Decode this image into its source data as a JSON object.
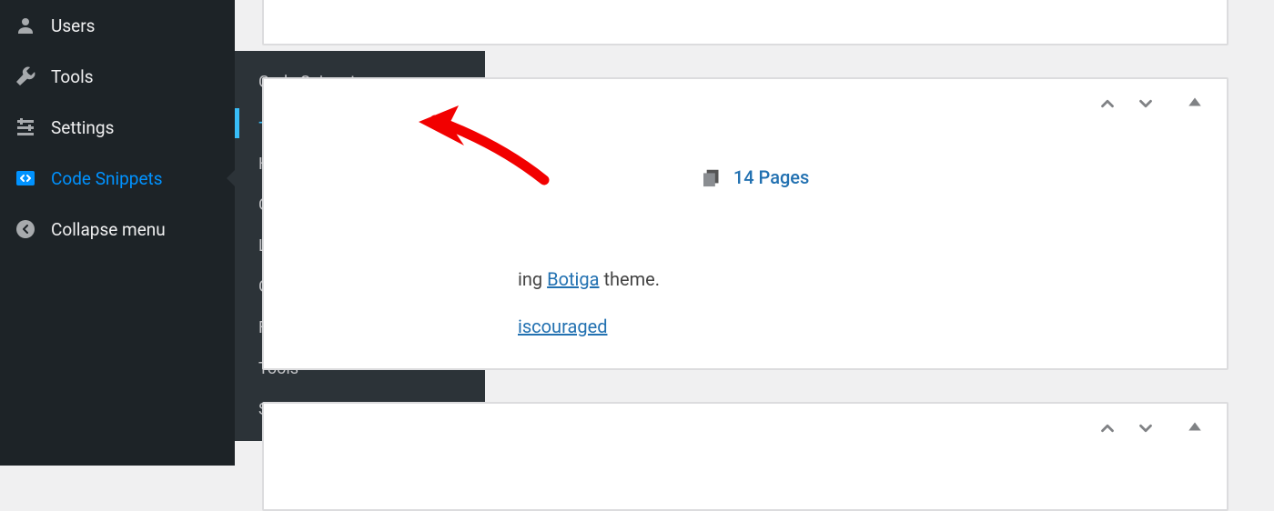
{
  "sidebar": {
    "items": [
      {
        "label": "Users",
        "iconName": "users-icon"
      },
      {
        "label": "Tools",
        "iconName": "wrench-icon"
      },
      {
        "label": "Settings",
        "iconName": "sliders-icon"
      },
      {
        "label": "Code Snippets",
        "iconName": "code-icon"
      }
    ],
    "collapse_label": "Collapse menu"
  },
  "submenu": {
    "items": [
      "Code Snippets",
      "+ Add Snippet",
      "Header & Footer",
      "Conversion Pixels",
      "Library",
      "Generator",
      "File Editor",
      "Tools",
      "Settings"
    ]
  },
  "pages": {
    "count_label": "14 Pages"
  },
  "theme_line": {
    "prefix_visible": "ing ",
    "link": "Botiga",
    "suffix": " theme."
  },
  "warning": {
    "link_visible": "iscouraged"
  }
}
